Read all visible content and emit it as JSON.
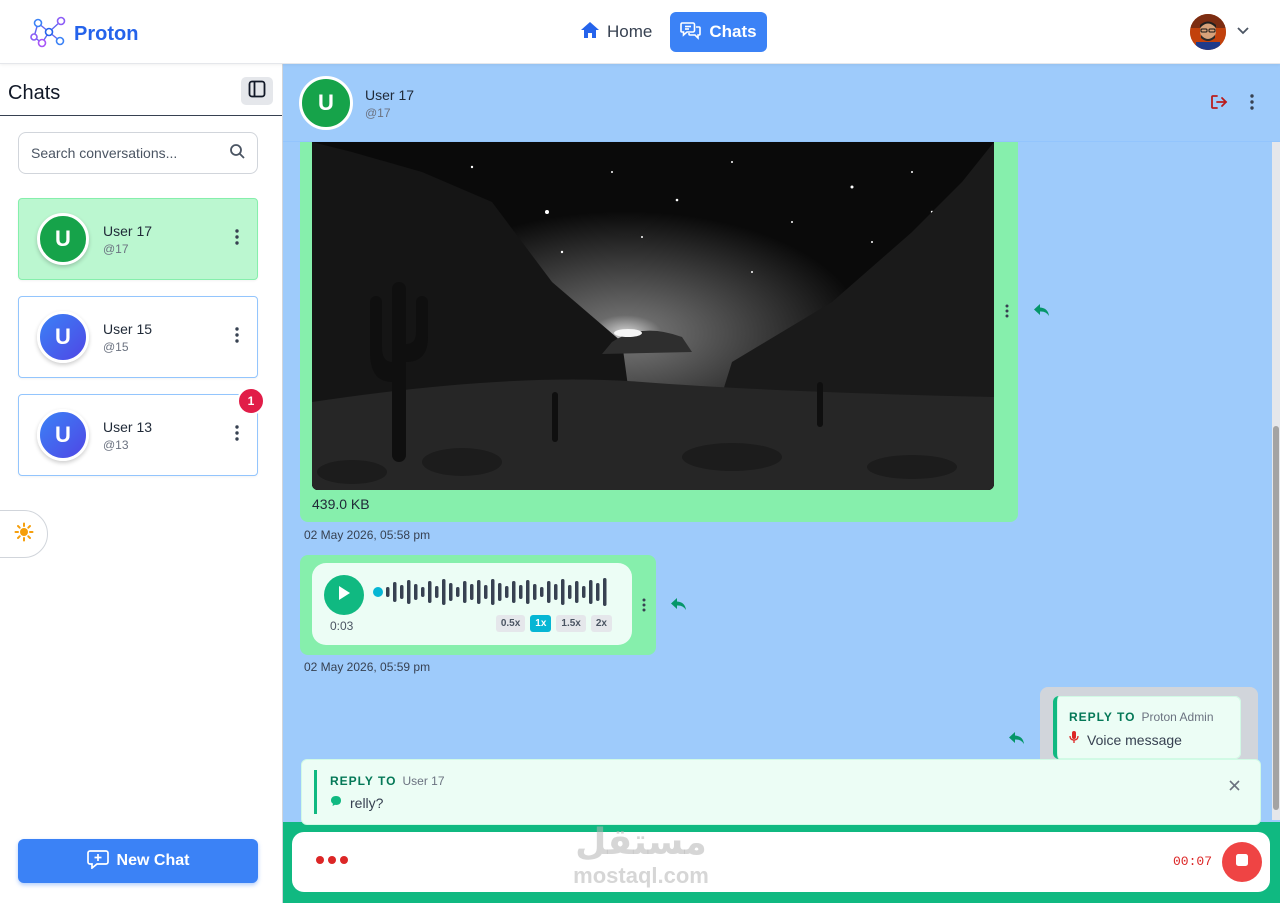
{
  "app": {
    "brand": "Proton"
  },
  "nav": {
    "home": "Home",
    "chats": "Chats"
  },
  "sidebar": {
    "title": "Chats",
    "search_placeholder": "Search conversations...",
    "conversations": [
      {
        "initial": "U",
        "name": "User 17",
        "handle": "@17",
        "active": true,
        "badge": ""
      },
      {
        "initial": "U",
        "name": "User 15",
        "handle": "@15",
        "active": false,
        "badge": ""
      },
      {
        "initial": "U",
        "name": "User 13",
        "handle": "@13",
        "active": false,
        "badge": "1"
      }
    ],
    "new_chat": "New Chat"
  },
  "chat": {
    "header": {
      "initial": "U",
      "name": "User 17",
      "handle": "@17"
    },
    "messages": {
      "image": {
        "file_size": "439.0 KB",
        "timestamp": "02 May 2026, 05:58 pm"
      },
      "voice": {
        "duration": "0:03",
        "speeds": [
          "0.5x",
          "1x",
          "1.5x",
          "2x"
        ],
        "active_speed": "1x",
        "timestamp": "02 May 2026, 05:59 pm"
      },
      "outgoing": {
        "reply_to_label": "REPLY TO",
        "reply_to_user": "Proton Admin",
        "reply_preview": "Voice message"
      }
    },
    "reply_bar": {
      "label": "REPLY TO",
      "user": "User 17",
      "preview": "relly?"
    },
    "composer": {
      "recording_time": "00:07"
    }
  },
  "watermark": {
    "arabic": "مستقل",
    "latin": "mostaql.com"
  },
  "colors": {
    "accent": "#3b82f6",
    "chat_bg": "#9ecbfb",
    "bubble": "#86efac",
    "green": "#10b981",
    "danger": "#ef4444"
  }
}
